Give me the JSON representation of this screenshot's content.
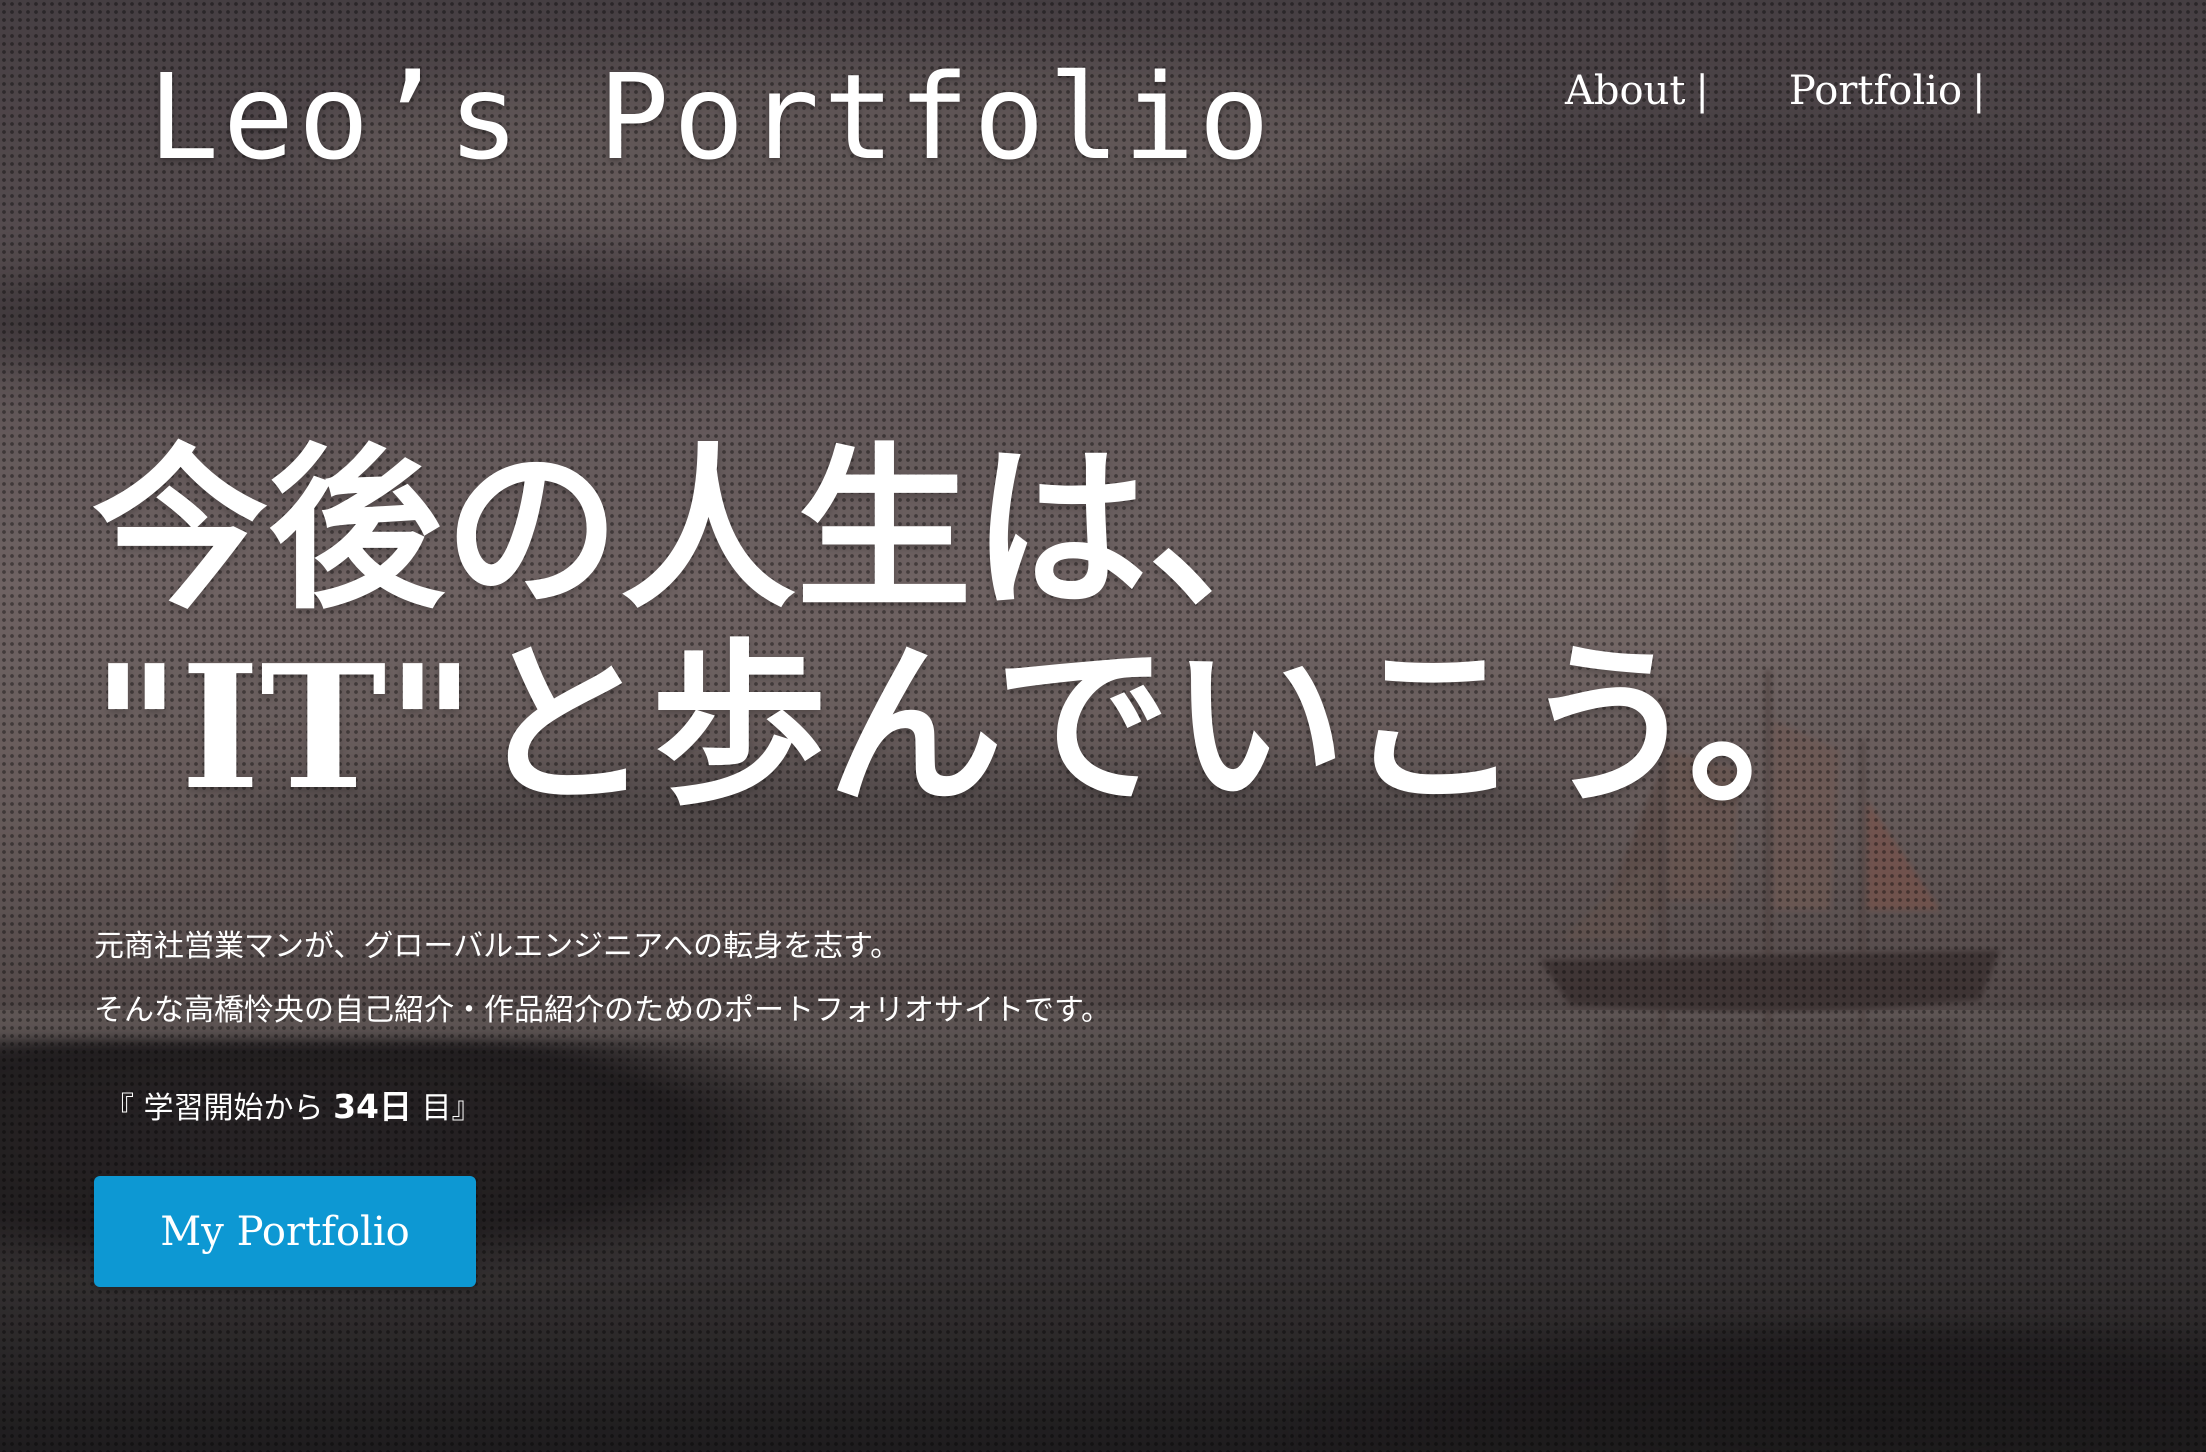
{
  "header": {
    "logo_text": "Leo’s Portfolio",
    "nav": [
      {
        "label": "About",
        "separator": "|"
      },
      {
        "label": "Portfolio",
        "separator": "|"
      }
    ]
  },
  "hero": {
    "headline_line1": "今後の人生は、",
    "headline_line2_quote": "\"IT\"",
    "headline_line2_rest": "と歩んでいこう。",
    "description_line1": "元商社営業マンが、グローバルエンジニアへの転身を志す。",
    "description_line2": "そんな高橋怜央の自己紹介・作品紹介のためのポートフォリオサイトです。",
    "days_prefix": "『 学習開始から ",
    "days_count": "34日",
    "days_suffix": " 目』",
    "cta_label": "My Portfolio"
  },
  "colors": {
    "cta_background": "#0d98d3",
    "text": "#ffffff"
  }
}
